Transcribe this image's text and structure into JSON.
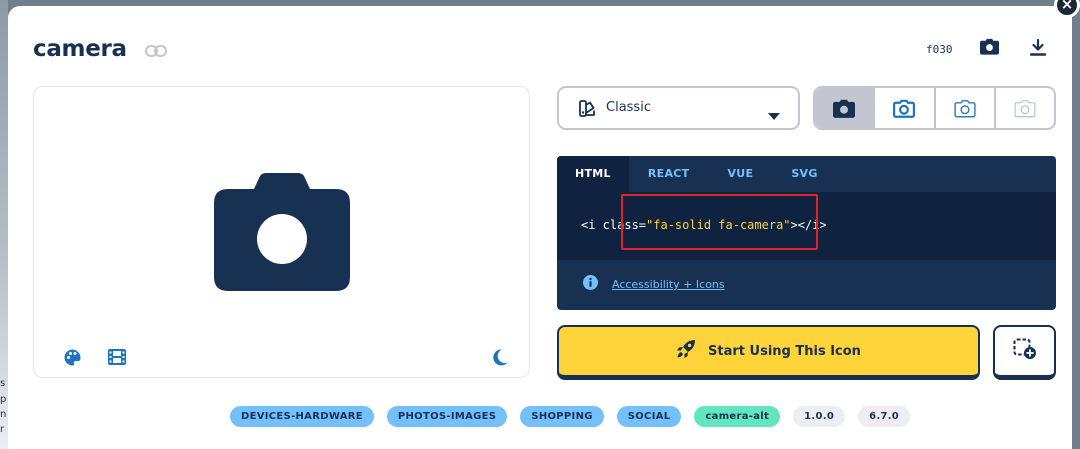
{
  "icon": {
    "name": "camera",
    "unicode": "f030"
  },
  "style_selector": {
    "selected": "Classic"
  },
  "code": {
    "tabs": [
      "HTML",
      "REACT",
      "VUE",
      "SVG"
    ],
    "active_tab": "HTML",
    "snippet": {
      "prefix": "<i class=",
      "value": "\"fa-solid fa-camera\"",
      "suffix": "></i>"
    },
    "accessibility_link": "Accessibility + Icons"
  },
  "actions": {
    "start_label": "Start Using This Icon"
  },
  "tags": {
    "categories": [
      "DEVICES-HARDWARE",
      "PHOTOS-IMAGES",
      "SHOPPING",
      "SOCIAL"
    ],
    "alias": "camera-alt",
    "versions": [
      "1.0.0",
      "6.7.0"
    ]
  },
  "icons": {
    "header": [
      "link-icon",
      "camera-icon",
      "download-icon"
    ],
    "preview": [
      "palette-icon",
      "film-icon",
      "moon-icon"
    ],
    "variants": [
      "camera-solid-icon",
      "camera-regular-icon",
      "camera-light-icon",
      "camera-thin-icon"
    ]
  },
  "colors": {
    "navy": "#183153",
    "code_bg": "#0f2341",
    "accent_yellow": "#ffd43b",
    "tag_blue": "#74c0fc",
    "tag_green": "#63e6be",
    "preview_icon_blue": "#1e74c0",
    "highlight_red": "#e02424"
  }
}
